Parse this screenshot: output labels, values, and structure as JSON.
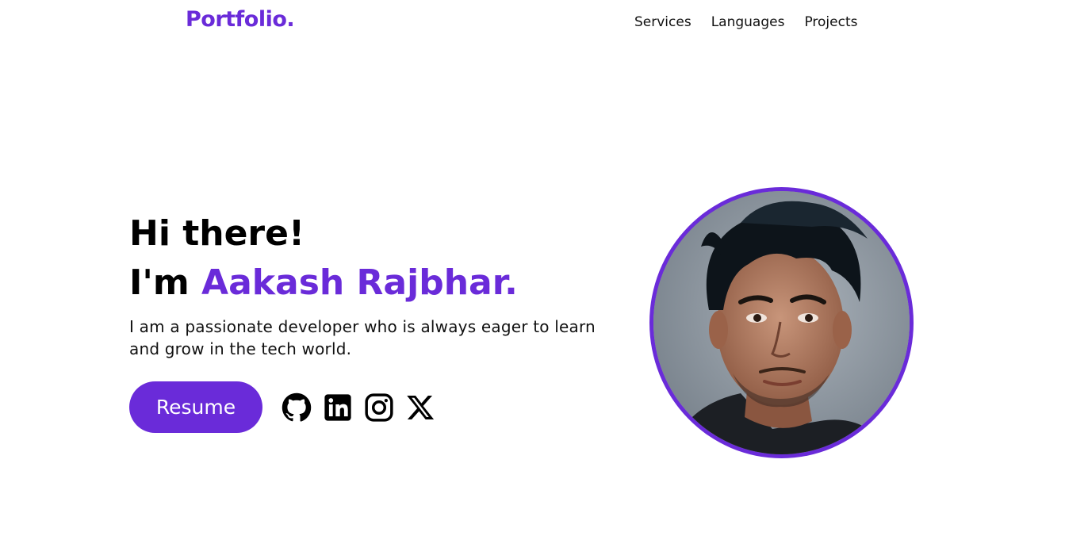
{
  "header": {
    "logo": "Portfolio.",
    "nav": [
      {
        "label": "Services"
      },
      {
        "label": "Languages"
      },
      {
        "label": "Projects"
      }
    ]
  },
  "hero": {
    "greeting": "Hi there!",
    "intro_prefix": "I'm ",
    "name": "Aakash Rajbhar.",
    "tagline": "I am a passionate developer who is always eager to learn and grow in the tech world.",
    "resume_label": "Resume",
    "socials": [
      {
        "icon": "github-icon"
      },
      {
        "icon": "linkedin-icon"
      },
      {
        "icon": "instagram-icon"
      },
      {
        "icon": "x-icon"
      }
    ]
  },
  "colors": {
    "accent": "#6a2bd9"
  }
}
